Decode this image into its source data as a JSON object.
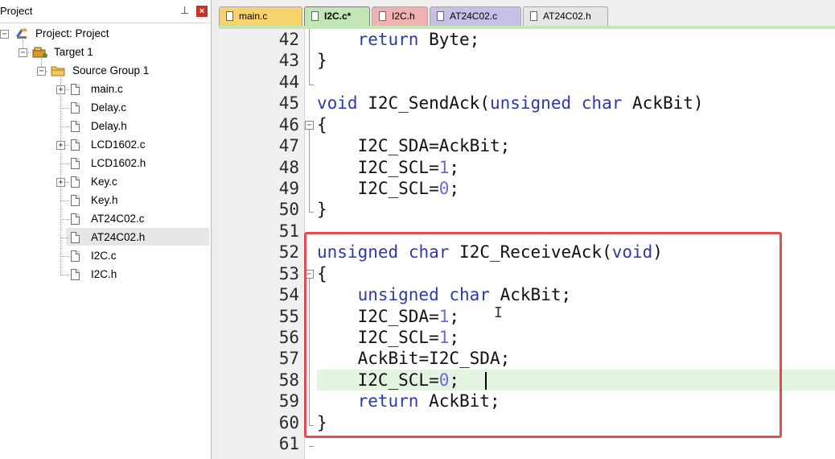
{
  "project_panel": {
    "title": "Project",
    "pin_icon": "pin-icon",
    "close_icon": "close-icon",
    "tree": {
      "project": "Project: Project",
      "target": "Target 1",
      "group": "Source Group 1",
      "files": [
        "main.c",
        "Delay.c",
        "Delay.h",
        "LCD1602.c",
        "LCD1602.h",
        "Key.c",
        "Key.h",
        "AT24C02.c",
        "AT24C02.h",
        "I2C.c",
        "I2C.h"
      ],
      "selected": "AT24C02.h"
    }
  },
  "tabs": [
    {
      "label": "main.c",
      "color": "#f6d36c"
    },
    {
      "label": "I2C.c*",
      "color": "#c2e6b4",
      "active": true
    },
    {
      "label": "I2C.h",
      "color": "#f2b0b0"
    },
    {
      "label": "AT24C02.c",
      "color": "#c8bfe6"
    },
    {
      "label": "AT24C02.h",
      "color": "#e6e6e6"
    }
  ],
  "editor": {
    "current_line": "58",
    "lines": [
      {
        "n": "42",
        "t": "    return Byte;"
      },
      {
        "n": "43",
        "t": "}"
      },
      {
        "n": "44",
        "t": ""
      },
      {
        "n": "45",
        "t": "void I2C_SendAck(unsigned char AckBit)"
      },
      {
        "n": "46",
        "t": "{"
      },
      {
        "n": "47",
        "t": "    I2C_SDA=AckBit;"
      },
      {
        "n": "48",
        "t": "    I2C_SCL=1;"
      },
      {
        "n": "49",
        "t": "    I2C_SCL=0;"
      },
      {
        "n": "50",
        "t": "}"
      },
      {
        "n": "51",
        "t": ""
      },
      {
        "n": "52",
        "t": "unsigned char I2C_ReceiveAck(void)"
      },
      {
        "n": "53",
        "t": "{"
      },
      {
        "n": "54",
        "t": "    unsigned char AckBit;"
      },
      {
        "n": "55",
        "t": "    I2C_SDA=1;"
      },
      {
        "n": "56",
        "t": "    I2C_SCL=1;"
      },
      {
        "n": "57",
        "t": "    AckBit=I2C_SDA;"
      },
      {
        "n": "58",
        "t": "    I2C_SCL=0;"
      },
      {
        "n": "59",
        "t": "    return AckBit;"
      },
      {
        "n": "60",
        "t": "}"
      },
      {
        "n": "61",
        "t": ""
      }
    ],
    "keyword_color": "#2e3aa8",
    "number_color": "#6a6ae0",
    "highlight_color": "#e24d4d"
  }
}
